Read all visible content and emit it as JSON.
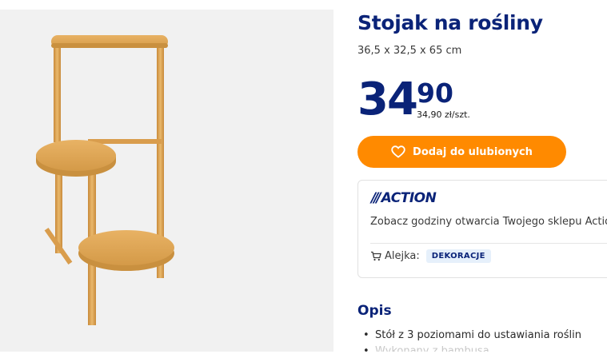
{
  "product": {
    "title": "Stojak na rośliny",
    "dimensions": "36,5 x 32,5 x 65 cm",
    "image_alt": "bamboo three-tier plant stand",
    "price": {
      "integer": "34",
      "decimal": "90",
      "unit_price": "34,90 zł/szt."
    },
    "favorite_button_label": "Dodaj do ulubionych"
  },
  "store": {
    "logo_text": "ACTION",
    "opening_hours_text": "Zobacz godziny otwarcia Twojego sklepu Action",
    "aisle_label": "Alejka:",
    "aisle_value": "DEKORACJE"
  },
  "description": {
    "heading": "Opis",
    "bullets": [
      "Stół z 3 poziomami do ustawiania roślin",
      "Wykonany z bambusa"
    ]
  },
  "colors": {
    "brand_blue": "#0a2378",
    "accent_orange": "#ff8a00",
    "badge_bg": "#e6f0fb",
    "bamboo": "#e2a85a"
  },
  "icons": {
    "favorite": "heart-icon",
    "aisle": "cart-icon"
  }
}
